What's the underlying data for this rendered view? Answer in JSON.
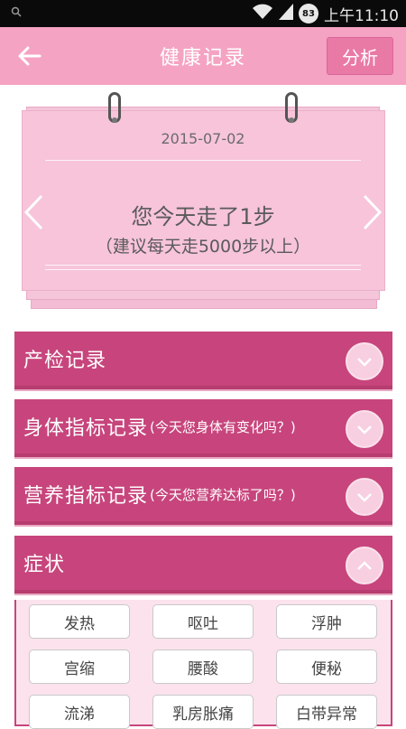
{
  "status_bar": {
    "time": "上午11:10",
    "battery": "83",
    "icons": [
      "search-icon",
      "wifi-icon",
      "signal-icon",
      "battery-icon"
    ]
  },
  "header": {
    "title": "健康记录",
    "back_icon": "back-arrow-icon",
    "analyze_label": "分析"
  },
  "calendar": {
    "date": "2015-07-02",
    "steps_text": "您今天走了1步",
    "advice_text": "（建议每天走5000步以上）",
    "prev_icon": "chevron-left-icon",
    "next_icon": "chevron-right-icon"
  },
  "sections": [
    {
      "title": "产检记录",
      "hint": "",
      "icon": "chevron-down-icon"
    },
    {
      "title": "身体指标记录",
      "hint": "(今天您身体有变化吗？)",
      "icon": "chevron-down-icon"
    },
    {
      "title": "营养指标记录",
      "hint": "(今天您营养达标了吗？)",
      "icon": "chevron-down-icon"
    },
    {
      "title": "症状",
      "hint": "",
      "icon": "chevron-up-icon"
    }
  ],
  "symptoms": [
    "发热",
    "呕吐",
    "浮肿",
    "宫缩",
    "腰酸",
    "便秘",
    "流涕",
    "乳房胀痛",
    "白带异常"
  ],
  "colors": {
    "header_bg": "#f5a3c2",
    "section_bg": "#c7457c",
    "card_bg": "#f7c4da",
    "panel_bg": "#fbe2ec"
  }
}
